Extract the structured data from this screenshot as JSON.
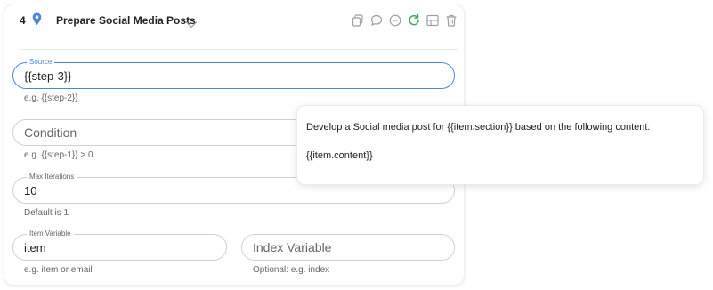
{
  "step": {
    "number": "4",
    "title": "Prepare Social Media Posts"
  },
  "actions": [
    {
      "name": "duplicate-icon"
    },
    {
      "name": "comment-icon"
    },
    {
      "name": "disable-icon"
    },
    {
      "name": "refresh-icon"
    },
    {
      "name": "layout-icon"
    },
    {
      "name": "trash-icon"
    }
  ],
  "colors": {
    "accent": "#4b87d6",
    "refresh_icon": "#3ea861",
    "icon_gray": "#9aa0a6"
  },
  "fields": {
    "source": {
      "label": "Source",
      "value": "{{step-3}}",
      "helper": "e.g. {{step-2}}"
    },
    "condition": {
      "placeholder": "Condition",
      "value": "",
      "helper": "e.g. {{step-1}} > 0"
    },
    "max_iterations": {
      "label": "Max Iterations",
      "value": "10",
      "helper": "Default is 1"
    },
    "item_variable": {
      "label": "Item Variable",
      "value": "item",
      "helper": "e.g. item or email"
    },
    "index_variable": {
      "placeholder": "Index Variable",
      "value": "",
      "helper": "Optional: e.g. index"
    }
  },
  "tooltip": {
    "line1": "Develop a Social media post for {{item.section}} based on the following content:",
    "line2": "{{item.content}}"
  }
}
